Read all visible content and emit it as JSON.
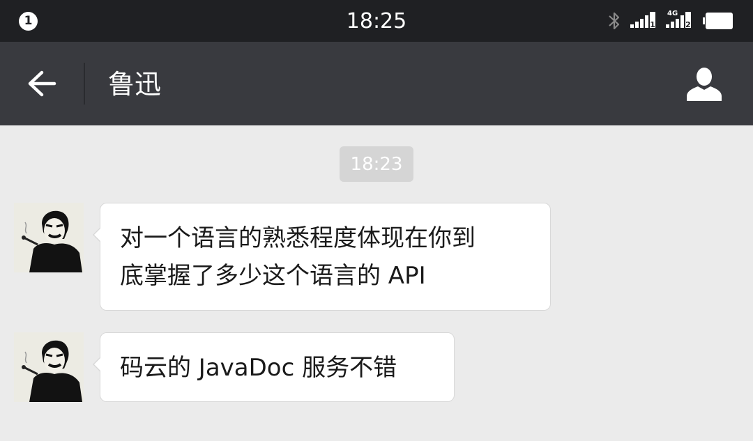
{
  "status_bar": {
    "notification_count": "1",
    "time": "18:25",
    "sim1_label": "1",
    "sim2_label": "2",
    "network_type": "4G",
    "icons": [
      "bluetooth-icon",
      "signal-icon",
      "signal-icon",
      "battery-icon"
    ]
  },
  "nav": {
    "title": "鲁迅",
    "back_icon": "arrow-left-icon",
    "profile_icon": "person-icon"
  },
  "chat": {
    "timestamp": "18:23",
    "messages": [
      {
        "sender": "鲁迅",
        "lines": [
          "对一个语言的熟悉程度体现在你到",
          "底掌握了多少这个语言的 API"
        ]
      },
      {
        "sender": "鲁迅",
        "lines": [
          "码云的 JavaDoc 服务不错"
        ]
      }
    ]
  },
  "colors": {
    "status_bar_bg": "#1f2023",
    "nav_bg": "#393a3f",
    "chat_bg": "#ebebeb",
    "bubble_bg": "#ffffff",
    "timestamp_bg": "#d5d5d5"
  }
}
